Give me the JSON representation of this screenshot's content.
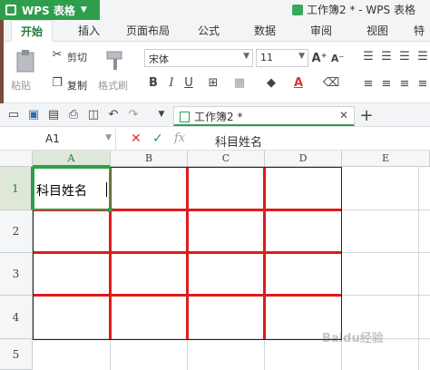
{
  "app": {
    "name": "WPS 表格",
    "doc_title": "工作簿2 * - WPS 表格"
  },
  "ribbon_tabs": [
    "开始",
    "插入",
    "页面布局",
    "公式",
    "数据",
    "审阅",
    "视图",
    "特色"
  ],
  "clipboard": {
    "paste": "粘贴",
    "cut": "剪切",
    "copy": "复制",
    "format_painter": "格式刷"
  },
  "font": {
    "family": "宋体",
    "size": "11"
  },
  "quick_access": {
    "document_tab": "工作簿2 *"
  },
  "formula_bar": {
    "cell_ref": "A1",
    "fx": "fx",
    "content": "科目姓名"
  },
  "columns": [
    "A",
    "B",
    "C",
    "D",
    "E"
  ],
  "rows": [
    "1",
    "2",
    "3",
    "4",
    "5"
  ],
  "cells": {
    "A1": "科目姓名"
  },
  "watermark": "Baidu经验",
  "colors": {
    "brand": "#2f9e4c",
    "border_red": "#e01b1b"
  }
}
